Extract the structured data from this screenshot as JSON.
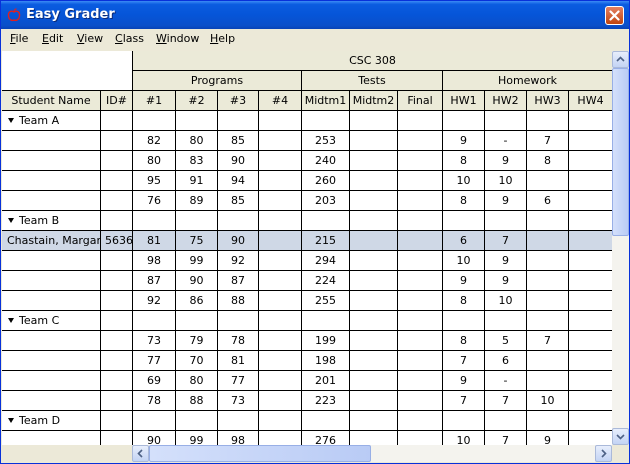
{
  "window": {
    "title": "Easy Grader"
  },
  "menu": [
    {
      "label": "File",
      "acc": "F",
      "rest": "ile"
    },
    {
      "label": "Edit",
      "acc": "E",
      "rest": "dit"
    },
    {
      "label": "View",
      "acc": "V",
      "rest": "iew"
    },
    {
      "label": "Class",
      "acc": "C",
      "rest": "lass"
    },
    {
      "label": "Window",
      "acc": "W",
      "rest": "indow"
    },
    {
      "label": "Help",
      "acc": "H",
      "rest": "elp"
    }
  ],
  "grid": {
    "course": "CSC 308",
    "groups": [
      "Programs",
      "Tests",
      "Homework"
    ],
    "columns": [
      "Student Name",
      "ID#",
      "#1",
      "#2",
      "#3",
      "#4",
      "Midtm1",
      "Midtm2",
      "Final",
      "HW1",
      "HW2",
      "HW3",
      "HW4"
    ],
    "rows": [
      {
        "team": "Team A"
      },
      {
        "cells": [
          "",
          "",
          "82",
          "80",
          "85",
          "",
          "253",
          "",
          "",
          "9",
          "-",
          "7",
          ""
        ]
      },
      {
        "cells": [
          "",
          "",
          "80",
          "83",
          "90",
          "",
          "240",
          "",
          "",
          "8",
          "9",
          "8",
          ""
        ]
      },
      {
        "cells": [
          "",
          "",
          "95",
          "91",
          "94",
          "",
          "260",
          "",
          "",
          "10",
          "10",
          "",
          ""
        ]
      },
      {
        "cells": [
          "",
          "",
          "76",
          "89",
          "85",
          "",
          "203",
          "",
          "",
          "8",
          "9",
          "6",
          ""
        ]
      },
      {
        "team": "Team B"
      },
      {
        "cells": [
          "Chastain, Margaret",
          "5636",
          "81",
          "75",
          "90",
          "",
          "215",
          "",
          "",
          "6",
          "7",
          "",
          ""
        ],
        "selected": true
      },
      {
        "cells": [
          "",
          "",
          "98",
          "99",
          "92",
          "",
          "294",
          "",
          "",
          "10",
          "9",
          "",
          ""
        ]
      },
      {
        "cells": [
          "",
          "",
          "87",
          "90",
          "87",
          "",
          "224",
          "",
          "",
          "9",
          "9",
          "",
          ""
        ]
      },
      {
        "cells": [
          "",
          "",
          "92",
          "86",
          "88",
          "",
          "255",
          "",
          "",
          "8",
          "10",
          "",
          ""
        ]
      },
      {
        "team": "Team C"
      },
      {
        "cells": [
          "",
          "",
          "73",
          "79",
          "78",
          "",
          "199",
          "",
          "",
          "8",
          "5",
          "7",
          ""
        ]
      },
      {
        "cells": [
          "",
          "",
          "77",
          "70",
          "81",
          "",
          "198",
          "",
          "",
          "7",
          "6",
          "",
          ""
        ]
      },
      {
        "cells": [
          "",
          "",
          "69",
          "80",
          "77",
          "",
          "201",
          "",
          "",
          "9",
          "-",
          "",
          ""
        ]
      },
      {
        "cells": [
          "",
          "",
          "78",
          "88",
          "73",
          "",
          "223",
          "",
          "",
          "7",
          "7",
          "10",
          ""
        ]
      },
      {
        "team": "Team D"
      },
      {
        "cells": [
          "",
          "",
          "90",
          "99",
          "98",
          "",
          "276",
          "",
          "",
          "10",
          "7",
          "9",
          ""
        ]
      }
    ]
  },
  "colors": {
    "header_bg": "#ebead8",
    "selected_row": "#cfd8e6",
    "titlebar": "#0655d8"
  }
}
